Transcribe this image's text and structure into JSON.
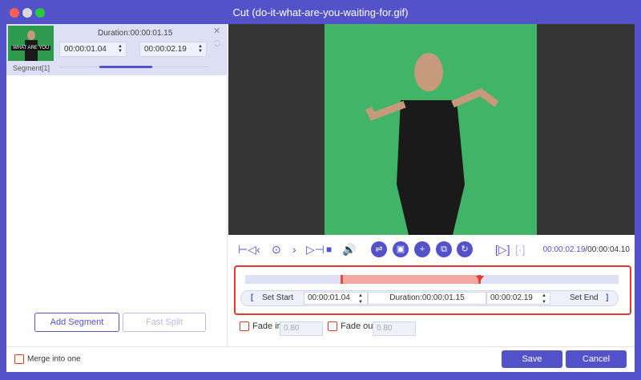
{
  "window": {
    "title": "Cut (do-it-what-are-you-waiting-for.gif)"
  },
  "segment": {
    "thumb_text": "WHAT ARE YOU",
    "label": "Segment[1]",
    "duration": "Duration:00:00:01.15",
    "start": "00:00:01.04",
    "end": "00:00:02.19"
  },
  "left_buttons": {
    "add_segment": "Add Segment",
    "fast_split": "Fast Split"
  },
  "player": {
    "current_time": "00:00:02.19",
    "total_time": "/00:00:04.10"
  },
  "cut": {
    "set_start": "Set Start",
    "start": "00:00:01.04",
    "duration": "Duration:00:00:01.15",
    "end": "00:00:02.19",
    "set_end": "Set End",
    "bracket_open": "[",
    "bracket_close": "]"
  },
  "fade": {
    "in_label": "Fade in",
    "in_value": "0.80",
    "out_label": "Fade out",
    "out_value": "0.80"
  },
  "bottom": {
    "merge_label": "Merge into one",
    "save": "Save",
    "cancel": "Cancel"
  },
  "colors": {
    "accent": "#5352c9",
    "highlight": "#e03a2e",
    "video_bg": "#41b468"
  }
}
